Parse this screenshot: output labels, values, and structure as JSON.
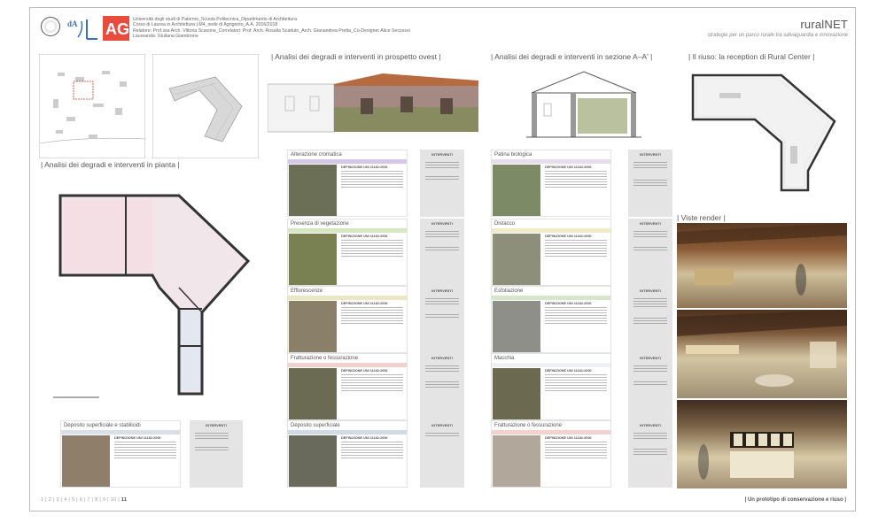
{
  "header": {
    "lines": [
      "Università degli studi di Palermo_Scuola Politecnica_Dipartimento di Architettura",
      "Corso di Laurea in Architettura LM4_sede di Agrigento_A.A. 2016/2018",
      "Relatore: Prof.ssa Arch. Vittoria Scavone_Correlatori: Prof. Arch. Rosalia Scaduto_Arch. Gianandrea Pretta_Co-Designer Alice Seccessi",
      "Laureanda: Giuliana Giambrone"
    ],
    "brand": "ruralNET",
    "tagline": "strategie per un parco rurale tra salvaguardia e innovazione"
  },
  "sections": {
    "prospetto": "| Analisi dei degradi e interventi in prospetto ovest |",
    "sezione": "| Analisi dei degradi e interventi in sezione A–A' |",
    "riuso": "| Il riuso: la reception di Rural Center |",
    "pianta": "| Analisi dei degradi e interventi in pianta |",
    "render": "| Viste render |"
  },
  "degradi_left": [
    {
      "title": "Alterazione cromatica",
      "band": "#d7c7e6",
      "photo": "#6b6f55",
      "int": "INTERVENTI"
    },
    {
      "title": "Presenza di vegetazione",
      "band": "#d6e8c2",
      "photo": "#7a8150",
      "int": "INTERVENTI"
    },
    {
      "title": "Efflorescenze",
      "band": "#ece7c3",
      "photo": "#8a8068",
      "int": "INTERVENTI"
    },
    {
      "title": "Fratturazione o fessurazione",
      "band": "#f1d2cf",
      "photo": "#6b6a52",
      "int": "INTERVENTI"
    },
    {
      "title": "Deposito superficiale",
      "band": "#d1dbe6",
      "photo": "#6a6a5c",
      "int": "INTERVENTI"
    }
  ],
  "degradi_right": [
    {
      "title": "Patina biologica",
      "band": "#e9dcef",
      "photo": "#7d8a66",
      "int": "INTERVENTI"
    },
    {
      "title": "Distacco",
      "band": "#f1eac8",
      "photo": "#8d8f7a",
      "int": "INTERVENTI"
    },
    {
      "title": "Esfoliazione",
      "band": "#d6e6c9",
      "photo": "#8e8f88",
      "int": "INTERVENTI"
    },
    {
      "title": "Macchia",
      "band": "#eef0f4",
      "photo": "#6c6a4e",
      "int": "INTERVENTI"
    },
    {
      "title": "Fratturazione o fessurazione",
      "band": "#f1d2cf",
      "photo": "#b1a79a",
      "int": "INTERVENTI"
    }
  ],
  "bottom_left_card": {
    "title": "Deposito superficiale e stabilicidi",
    "int": "INTERVENTI"
  },
  "card_head": "DEFINIZIONE UNI 11182:2006",
  "pager": {
    "pages": [
      "1",
      "2",
      "3",
      "4",
      "5",
      "6",
      "7",
      "8",
      "9",
      "10"
    ],
    "current": "11"
  },
  "footer": "| Un prototipo di conservazione e riuso |",
  "colors": {
    "accent": "#c0392b",
    "band_red": "#e74c3c"
  }
}
